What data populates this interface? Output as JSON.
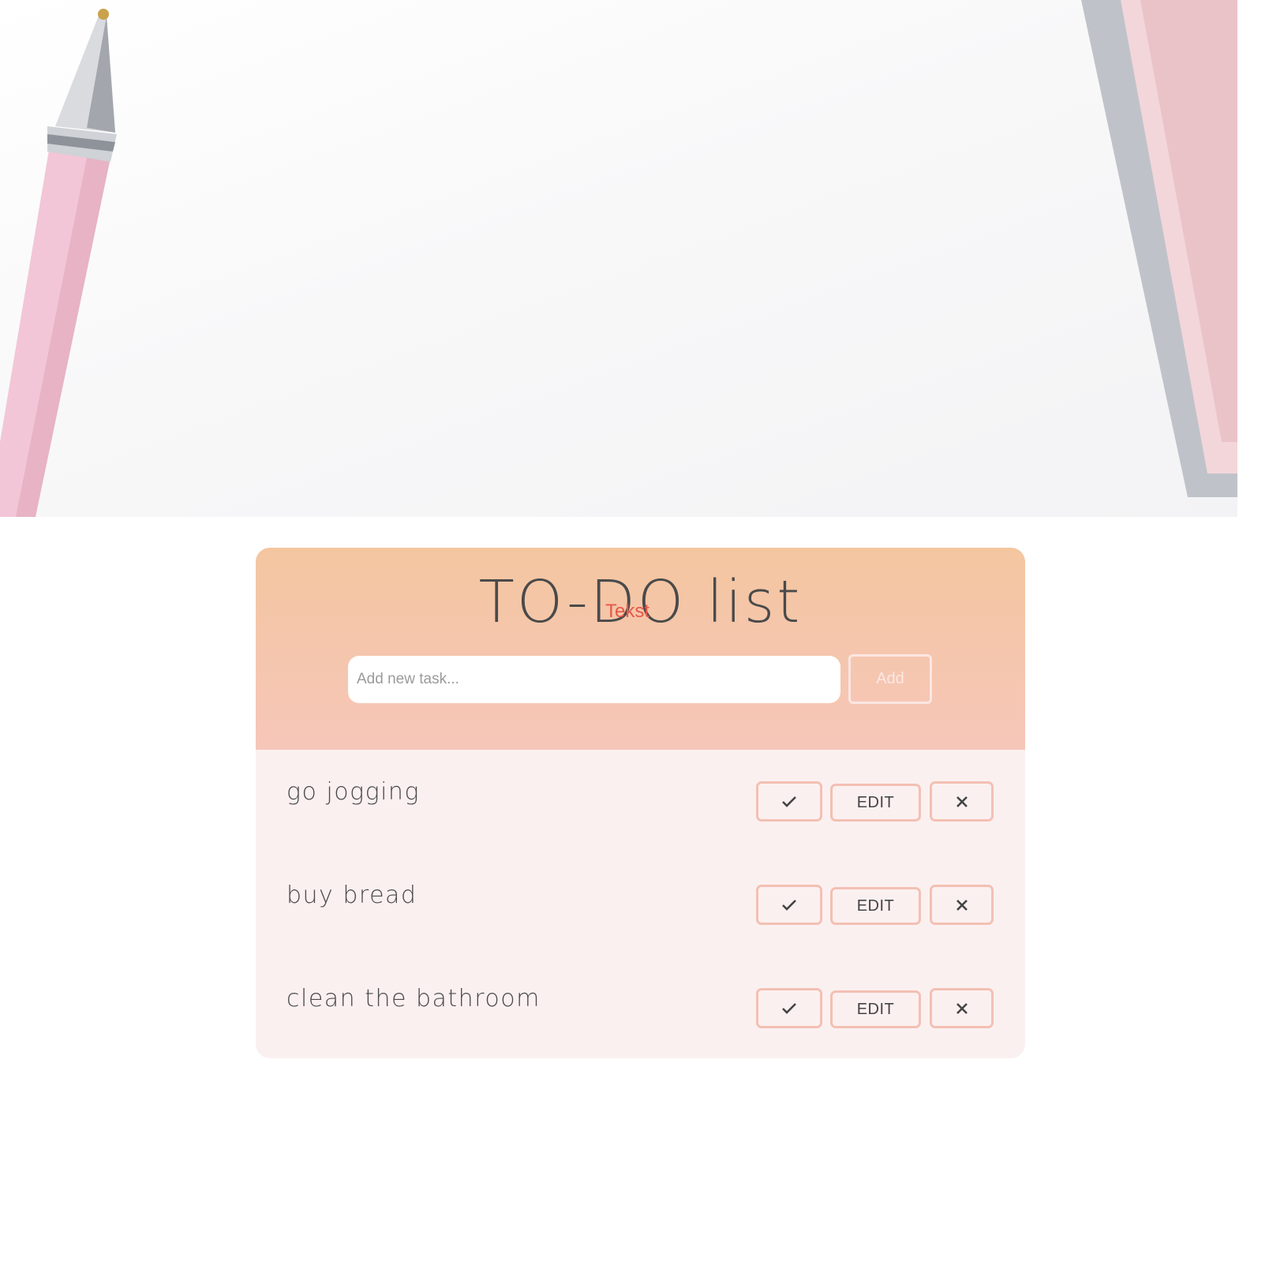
{
  "header": {
    "title": "TO-DO list",
    "overlay_text": "Tekst"
  },
  "new_task": {
    "placeholder": "Add new task...",
    "add_label": "Add"
  },
  "tasks": [
    {
      "text": "go jogging",
      "edit_label": "EDIT"
    },
    {
      "text": "buy bread",
      "edit_label": "EDIT"
    },
    {
      "text": "clean the bathroom",
      "edit_label": "EDIT"
    }
  ],
  "icons": {
    "complete": "check-icon",
    "delete": "close-icon"
  },
  "colors": {
    "header_gradient_top": "#f4c6a0",
    "header_gradient_bottom": "#f6c6b9",
    "list_background": "#fbf0f0",
    "button_border": "#f3c0b3",
    "text": "#4a4a4a",
    "overlay_text": "#e8574a"
  }
}
